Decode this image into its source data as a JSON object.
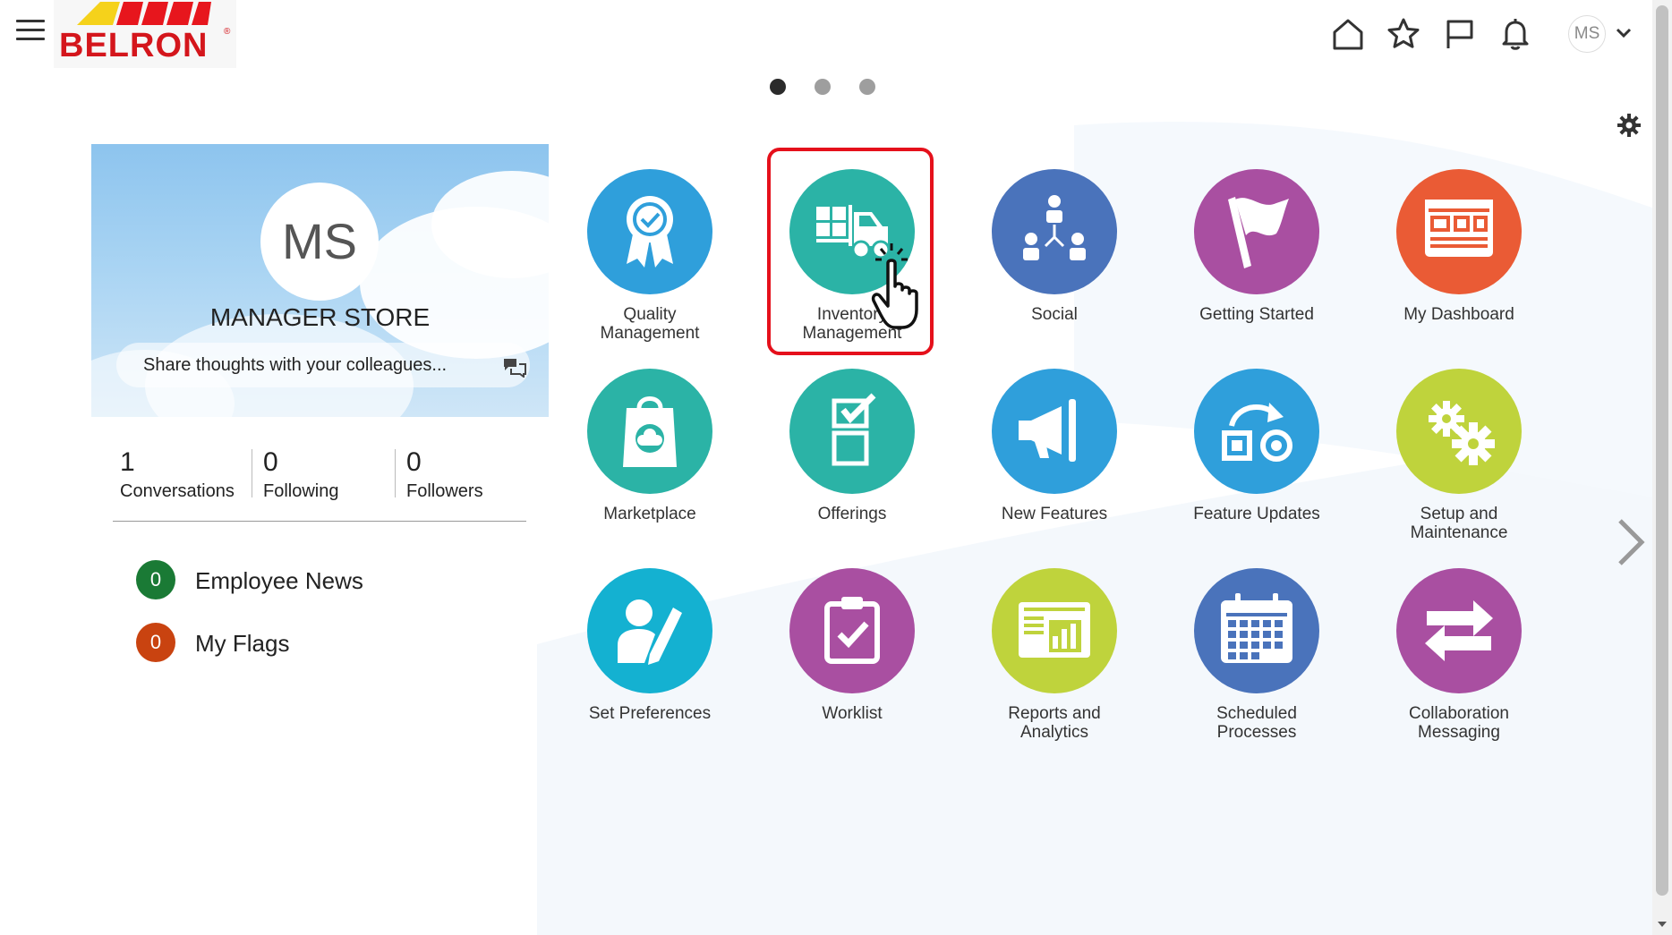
{
  "header": {
    "logo_text": "BELRON",
    "logo_mark": "®",
    "user_initials": "MS",
    "icons": [
      "home-icon",
      "star-icon",
      "flag-icon",
      "bell-icon",
      "chevron-down-icon"
    ]
  },
  "carousel": {
    "page_count": 3,
    "active_page": 1
  },
  "profile": {
    "initials": "MS",
    "name": "MANAGER STORE",
    "share_placeholder": "Share thoughts with your colleagues...",
    "stats": [
      {
        "value": "1",
        "label": "Conversations"
      },
      {
        "value": "0",
        "label": "Following"
      },
      {
        "value": "0",
        "label": "Followers"
      }
    ],
    "feeds": [
      {
        "count": "0",
        "label": "Employee News",
        "color": "#1a7a35"
      },
      {
        "count": "0",
        "label": "My Flags",
        "color": "#c94310"
      }
    ]
  },
  "tiles": [
    {
      "label_1": "Quality",
      "label_2": "Management",
      "color": "#2f9fdb",
      "icon": "ribbon-award-icon"
    },
    {
      "label_1": "Inventory",
      "label_2": "Management",
      "color": "#2bb3a6",
      "icon": "forklift-icon"
    },
    {
      "label_1": "Social",
      "label_2": "",
      "color": "#4a73bb",
      "icon": "people-network-icon"
    },
    {
      "label_1": "Getting Started",
      "label_2": "",
      "color": "#a94fa1",
      "icon": "flag-icon"
    },
    {
      "label_1": "My Dashboard",
      "label_2": "",
      "color": "#ea5b35",
      "icon": "dashboard-icon"
    },
    {
      "label_1": "Marketplace",
      "label_2": "",
      "color": "#2bb3a6",
      "icon": "shopping-bag-icon"
    },
    {
      "label_1": "Offerings",
      "label_2": "",
      "color": "#2bb3a6",
      "icon": "checklist-icon"
    },
    {
      "label_1": "New Features",
      "label_2": "",
      "color": "#2f9fdb",
      "icon": "megaphone-icon"
    },
    {
      "label_1": "Feature Updates",
      "label_2": "",
      "color": "#2f9fdb",
      "icon": "update-shapes-icon"
    },
    {
      "label_1": "Setup and",
      "label_2": "Maintenance",
      "color": "#bfd33c",
      "icon": "gears-icon"
    },
    {
      "label_1": "Set Preferences",
      "label_2": "",
      "color": "#14b1d1",
      "icon": "user-edit-icon"
    },
    {
      "label_1": "Worklist",
      "label_2": "",
      "color": "#a94fa1",
      "icon": "clipboard-check-icon"
    },
    {
      "label_1": "Reports and",
      "label_2": "Analytics",
      "color": "#bfd33c",
      "icon": "report-chart-icon"
    },
    {
      "label_1": "Scheduled",
      "label_2": "Processes",
      "color": "#4a73bb",
      "icon": "calendar-icon"
    },
    {
      "label_1": "Collaboration",
      "label_2": "Messaging",
      "color": "#a94fa1",
      "icon": "exchange-arrows-icon"
    }
  ]
}
